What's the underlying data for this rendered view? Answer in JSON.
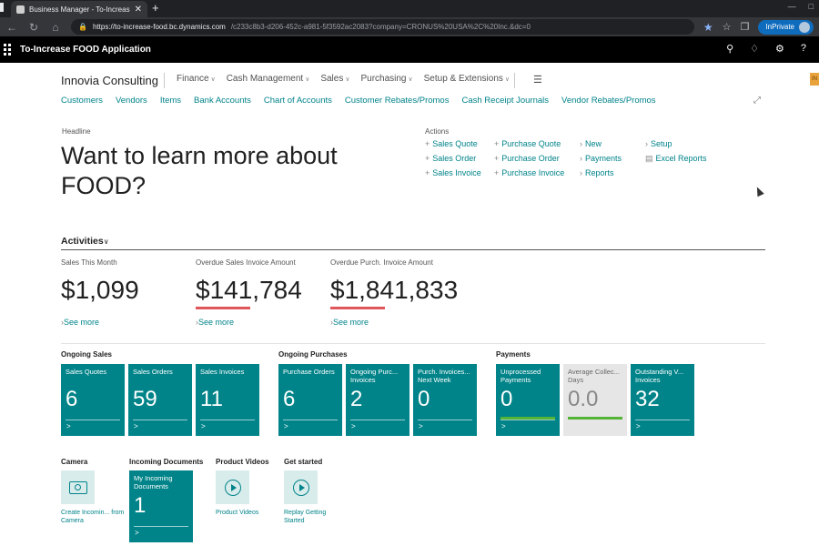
{
  "browser": {
    "tab_title": "Business Manager - To-Increase",
    "tab_close": "✕",
    "new_tab": "+",
    "url_main": "https://to-increase-food.bc.dynamics.com",
    "url_rest": "/c233c8b3-d206-452c-a981-5f3592ac2083?company=CRONUS%20USA%2C%20Inc.&dc=0",
    "inprivate_label": "InPrivate",
    "window_controls": [
      "—",
      "□"
    ]
  },
  "appbar": {
    "app_name": "To-Increase FOOD Application"
  },
  "nav": {
    "company": "Innovia Consulting",
    "menu": [
      "Finance",
      "Cash Management",
      "Sales",
      "Purchasing",
      "Setup & Extensions"
    ],
    "badge": "IN",
    "links": [
      "Customers",
      "Vendors",
      "Items",
      "Bank Accounts",
      "Chart of Accounts",
      "Customer Rebates/Promos",
      "Cash Receipt Journals",
      "Vendor Rebates/Promos"
    ]
  },
  "headline": {
    "label": "Headline",
    "text": "Want to learn more about FOOD?"
  },
  "actions": {
    "label": "Actions",
    "col1": [
      "Sales Quote",
      "Sales Order",
      "Sales Invoice"
    ],
    "col2": [
      "Purchase Quote",
      "Purchase Order",
      "Purchase Invoice"
    ],
    "col3": [
      "New",
      "Payments",
      "Reports"
    ],
    "col4": [
      "Setup",
      "Excel Reports"
    ]
  },
  "activities": {
    "title": "Activities",
    "cues": [
      {
        "label": "Sales This Month",
        "value": "$1,099",
        "see_more": "See more",
        "alert": false
      },
      {
        "label": "Overdue Sales Invoice Amount",
        "value": "$141,784",
        "see_more": "See more",
        "alert": true
      },
      {
        "label": "Overdue Purch. Invoice Amount",
        "value": "$1,841,833",
        "see_more": "See more",
        "alert": true
      }
    ]
  },
  "groups": {
    "ongoing_sales": "Ongoing Sales",
    "ongoing_purchases": "Ongoing Purchases",
    "payments": "Payments"
  },
  "tiles": [
    {
      "label": "Sales Quotes",
      "value": "6"
    },
    {
      "label": "Sales Orders",
      "value": "59"
    },
    {
      "label": "Sales Invoices",
      "value": "11"
    },
    {
      "label": "Purchase Orders",
      "value": "6"
    },
    {
      "label": "Ongoing Purc... Invoices",
      "value": "2"
    },
    {
      "label": "Purch. Invoices... Next Week",
      "value": "0"
    },
    {
      "label": "Unprocessed Payments",
      "value": "0"
    },
    {
      "label": "Average Collec... Days",
      "value": "0.0"
    },
    {
      "label": "Outstanding V... Invoices",
      "value": "32"
    }
  ],
  "tile_arrow": ">",
  "bottom": {
    "camera": {
      "title": "Camera",
      "caption": "Create Incomin... from Camera"
    },
    "incoming": {
      "title": "Incoming Documents",
      "tile_label": "My Incoming Documents",
      "value": "1"
    },
    "videos": {
      "title": "Product Videos",
      "caption": "Product Videos"
    },
    "started": {
      "title": "Get started",
      "caption": "Replay Getting Started"
    }
  }
}
